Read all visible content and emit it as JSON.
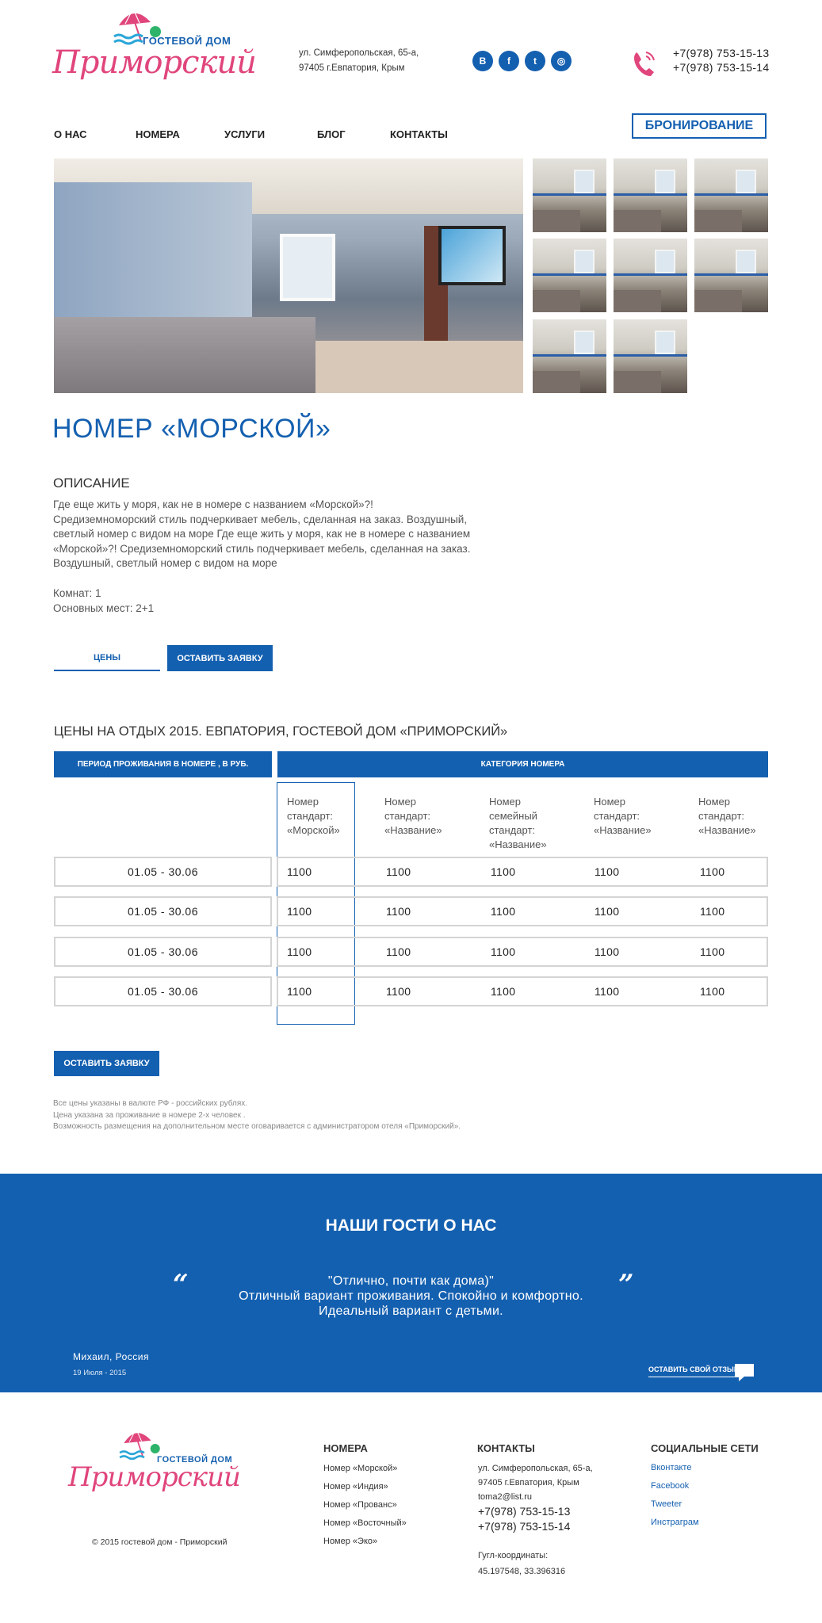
{
  "header": {
    "logo_small": "ГОСТЕВОЙ ДОМ",
    "logo_script": "Приморский",
    "address_line1": "ул. Симферопольская, 65-а,",
    "address_line2": "97405 г.Евпатория, Крым",
    "social": [
      "В",
      "f",
      "t",
      "◎"
    ],
    "phone1": "+7(978) 753-15-13",
    "phone2": "+7(978) 753-15-14"
  },
  "nav": {
    "items": [
      "О НАС",
      "НОМЕРА",
      "УСЛУГИ",
      "БЛОГ",
      "КОНТАКТЫ"
    ],
    "book_label": "БРОНИРОВАНИЕ"
  },
  "room": {
    "title": "НОМЕР «МОРСКОЙ»",
    "desc_heading": "ОПИСАНИЕ",
    "desc_lines": [
      "Где еще жить у моря, как не в номере с названием «Морской»?!",
      "Средиземноморский стиль подчеркивает мебель, сделанная на заказ. Воздушный,",
      "светлый номер с видом на море Где еще жить у моря, как не в номере с названием",
      "«Морской»?! Средиземноморский стиль подчеркивает мебель, сделанная на заказ.",
      "Воздушный, светлый номер с видом на море"
    ],
    "rooms": "Комнат: 1",
    "places": "Основных мест: 2+1",
    "tab_prices": "ЦЕНЫ",
    "request_label": "ОСТАВИТЬ ЗАЯВКУ"
  },
  "prices": {
    "heading": "ЦЕНЫ НА ОТДЫХ 2015. ЕВПАТОРИЯ, ГОСТЕВОЙ ДОМ «ПРИМОРСКИЙ»",
    "th_period": "ПЕРИОД ПРОЖИВАНИЯ В НОМЕРЕ ,  В РУБ.",
    "th_category": "КАТЕГОРИЯ НОМЕРА",
    "columns": [
      [
        "Номер",
        "стандарт:",
        "«Морской»"
      ],
      [
        "Номер",
        "стандарт:",
        "«Название»"
      ],
      [
        "Номер",
        "семейный",
        "стандарт:",
        "«Название»"
      ],
      [
        "Номер",
        "стандарт:",
        "«Название»"
      ],
      [
        "Номер",
        "стандарт:",
        "«Название»"
      ]
    ],
    "rows": [
      {
        "period": "01.05 - 30.06",
        "values": [
          "1100",
          "1100",
          "1100",
          "1100",
          "1100"
        ]
      },
      {
        "period": "01.05 - 30.06",
        "values": [
          "1100",
          "1100",
          "1100",
          "1100",
          "1100"
        ]
      },
      {
        "period": "01.05 - 30.06",
        "values": [
          "1100",
          "1100",
          "1100",
          "1100",
          "1100"
        ]
      },
      {
        "period": "01.05 - 30.06",
        "values": [
          "1100",
          "1100",
          "1100",
          "1100",
          "1100"
        ]
      }
    ],
    "request_label": "ОСТАВИТЬ ЗАЯВКУ",
    "notes": [
      "Все цены указаны в валюте РФ - российских рублях.",
      "Цена указана за проживание в номере 2-х человек .",
      "Возможность размещения на дополнительном месте оговаривается с администратором отеля «Приморский»."
    ]
  },
  "reviews": {
    "title": "НАШИ ГОСТИ О НАС",
    "lines": [
      "\"Отлично, почти как дома)\"",
      "Отличный вариант проживания. Спокойно и комфортно.",
      "Идеальный вариант с детьми."
    ],
    "author": "Михаил, Россия",
    "date": "19 Июля - 2015",
    "leave_review": "ОСТАВИТЬ СВОЙ ОТЗЫВ"
  },
  "footer": {
    "copyright": "© 2015 гостевой дом - Приморский",
    "rooms_heading": "НОМЕРА",
    "rooms_links": [
      "Номер «Морской»",
      "Номер «Индия»",
      "Номер «Прованс»",
      "Номер «Восточный»",
      "Номер «Эко»"
    ],
    "contacts_heading": "КОНТАКТЫ",
    "address_line1": "ул. Симферопольская, 65-а,",
    "address_line2": "97405 г.Евпатория, Крым",
    "email": "toma2@list.ru",
    "phone1": "+7(978) 753-15-13",
    "phone2": "+7(978) 753-15-14",
    "coords_label": "Гугл-координаты:",
    "coords": "45.197548, 33.396316",
    "social_heading": "СОЦИАЛЬНЫЕ СЕТИ",
    "social_links": [
      "Вконтакте",
      "Facebook",
      "Tweeter",
      "Инстраграм"
    ]
  },
  "colors": {
    "brand_blue": "#1460b0",
    "logo_pink": "#e0457b"
  }
}
